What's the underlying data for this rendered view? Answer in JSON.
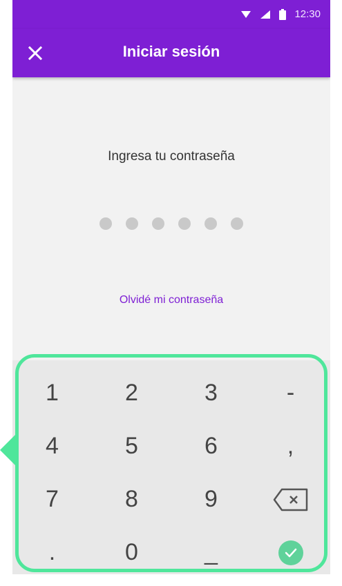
{
  "status_bar": {
    "time": "12:30",
    "icons": [
      "wifi-icon",
      "signal-icon",
      "battery-icon"
    ]
  },
  "app_bar": {
    "title": "Iniciar sesión",
    "close_icon": "close-icon",
    "background": "#7e1fd4"
  },
  "content": {
    "prompt": "Ingresa tu contraseña",
    "password_length": 6,
    "forgot_link": "Olvidé mi contraseña"
  },
  "keypad": {
    "keys": [
      "1",
      "2",
      "3",
      "-",
      "4",
      "5",
      "6",
      ",",
      "7",
      "8",
      "9",
      "backspace",
      ".",
      "0",
      "_",
      "confirm"
    ],
    "backspace_icon": "backspace-icon",
    "confirm_icon": "check-icon",
    "highlight_color": "#4fe69b",
    "confirm_color": "#5fd29a"
  }
}
